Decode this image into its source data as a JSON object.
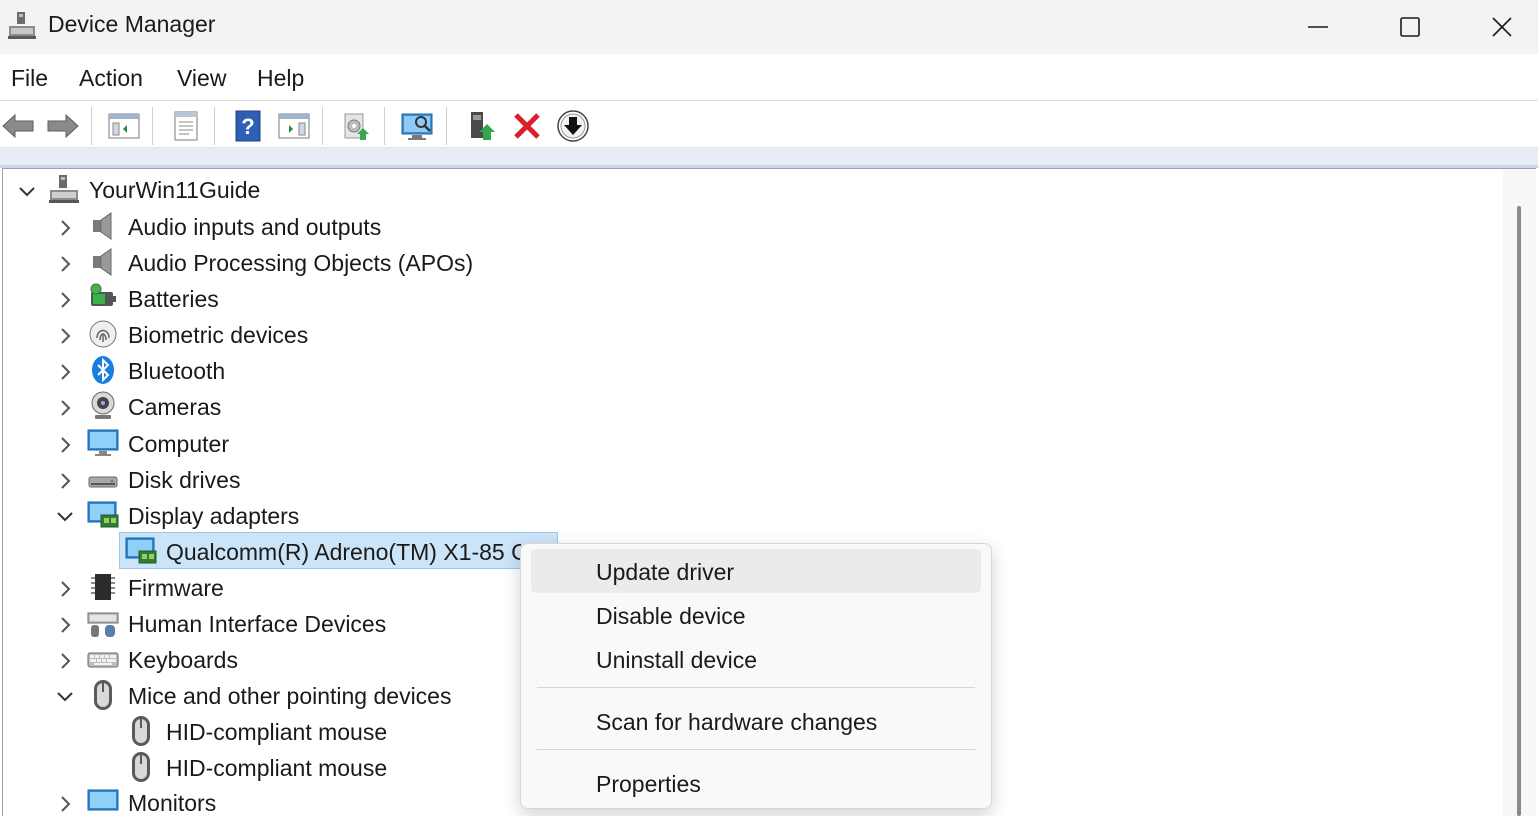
{
  "window": {
    "title": "Device Manager",
    "controls": {
      "minimize": "minimize",
      "maximize": "maximize",
      "close": "close"
    }
  },
  "menu": [
    "File",
    "Action",
    "View",
    "Help"
  ],
  "toolbar": {
    "buttons": [
      "back-arrow-icon",
      "forward-arrow-icon",
      "show-hide-console-tree-icon",
      "properties-sheet-icon",
      "help-icon",
      "action-pane-icon",
      "scan-hardware-icon",
      "monitor-search-icon",
      "update-driver-icon",
      "uninstall-device-icon",
      "disable-device-icon"
    ]
  },
  "tree": {
    "root": "YourWin11Guide",
    "categories": [
      {
        "label": "Audio inputs and outputs",
        "expanded": false,
        "icon": "speaker-icon"
      },
      {
        "label": "Audio Processing Objects (APOs)",
        "expanded": false,
        "icon": "speaker-icon"
      },
      {
        "label": "Batteries",
        "expanded": false,
        "icon": "battery-icon"
      },
      {
        "label": "Biometric devices",
        "expanded": false,
        "icon": "fingerprint-icon"
      },
      {
        "label": "Bluetooth",
        "expanded": false,
        "icon": "bluetooth-icon"
      },
      {
        "label": "Cameras",
        "expanded": false,
        "icon": "camera-icon"
      },
      {
        "label": "Computer",
        "expanded": false,
        "icon": "monitor-icon"
      },
      {
        "label": "Disk drives",
        "expanded": false,
        "icon": "disk-drive-icon"
      },
      {
        "label": "Display adapters",
        "expanded": true,
        "icon": "display-adapter-icon"
      },
      {
        "label": "Firmware",
        "expanded": false,
        "icon": "chip-icon"
      },
      {
        "label": "Human Interface Devices",
        "expanded": false,
        "icon": "hid-icon"
      },
      {
        "label": "Keyboards",
        "expanded": false,
        "icon": "keyboard-icon"
      },
      {
        "label": "Mice and other pointing devices",
        "expanded": true,
        "icon": "mouse-icon"
      },
      {
        "label": "Monitors",
        "expanded": false,
        "icon": "monitor-icon"
      }
    ],
    "display_adapter_child": "Qualcomm(R) Adreno(TM) X1-85 G",
    "mouse_children": [
      "HID-compliant mouse",
      "HID-compliant mouse"
    ]
  },
  "context_menu": {
    "items": [
      "Update driver",
      "Disable device",
      "Uninstall device",
      "Scan for hardware changes",
      "Properties"
    ]
  }
}
